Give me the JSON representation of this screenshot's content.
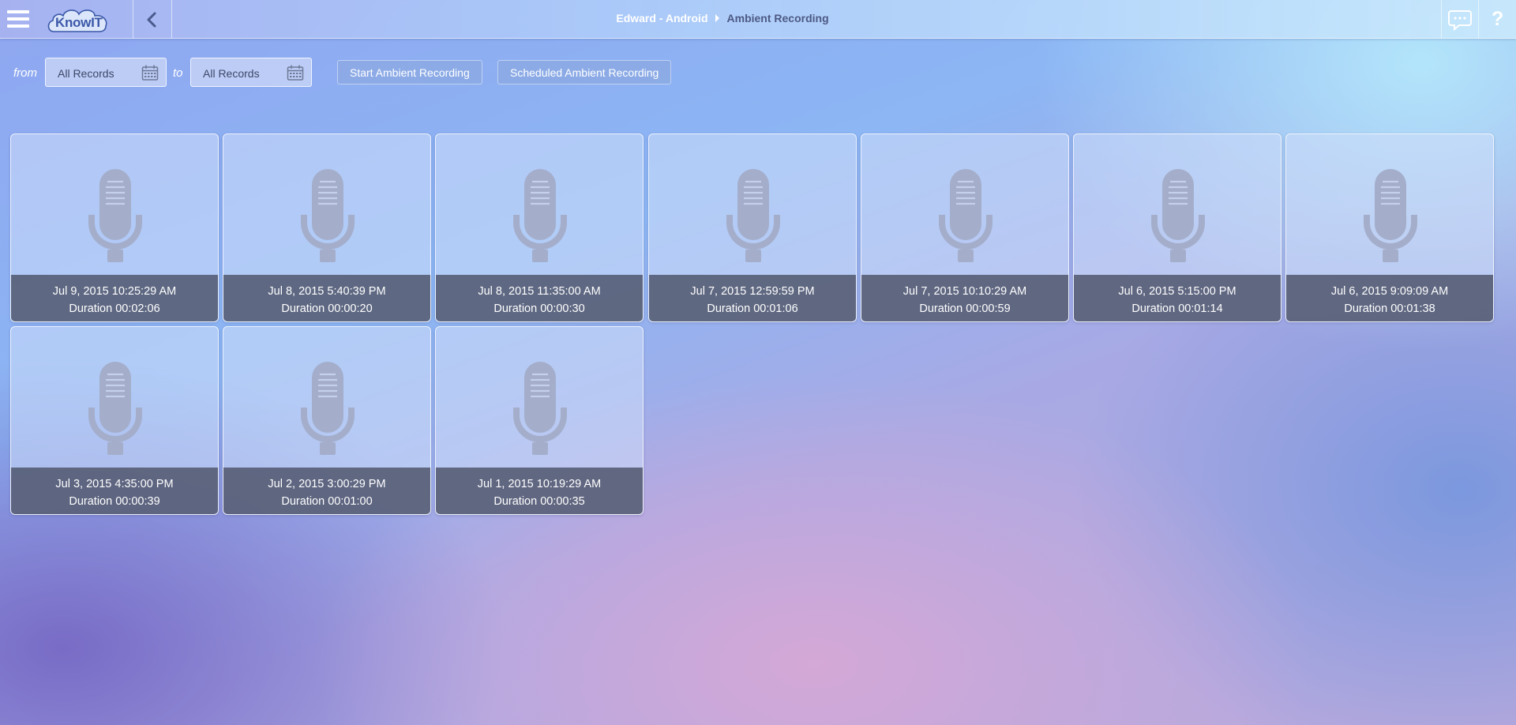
{
  "header": {
    "logo_text": "KnowIT",
    "breadcrumb": {
      "device": "Edward - Android",
      "current": "Ambient Recording"
    }
  },
  "icons": {
    "menu": "hamburger-menu-icon",
    "back": "chevron-left-icon",
    "chat": "chat-bubble-icon",
    "help": "question-mark-icon",
    "calendar": "calendar-icon",
    "microphone": "microphone-icon"
  },
  "help_glyph": "?",
  "filters": {
    "from_label": "from",
    "to_label": "to",
    "from_value": "All Records",
    "to_value": "All Records"
  },
  "actions": {
    "start": "Start Ambient Recording",
    "scheduled": "Scheduled Ambient Recording"
  },
  "recordings": [
    {
      "date": "Jul 9, 2015 10:25:29 AM",
      "duration": "Duration 00:02:06"
    },
    {
      "date": "Jul 8, 2015 5:40:39 PM",
      "duration": "Duration 00:00:20"
    },
    {
      "date": "Jul 8, 2015 11:35:00 AM",
      "duration": "Duration 00:00:30"
    },
    {
      "date": "Jul 7, 2015 12:59:59 PM",
      "duration": "Duration 00:01:06"
    },
    {
      "date": "Jul 7, 2015 10:10:29 AM",
      "duration": "Duration 00:00:59"
    },
    {
      "date": "Jul 6, 2015 5:15:00 PM",
      "duration": "Duration 00:01:14"
    },
    {
      "date": "Jul 6, 2015 9:09:09 AM",
      "duration": "Duration 00:01:38"
    },
    {
      "date": "Jul 3, 2015 4:35:00 PM",
      "duration": "Duration 00:00:39"
    },
    {
      "date": "Jul 2, 2015 3:00:29 PM",
      "duration": "Duration 00:01:00"
    },
    {
      "date": "Jul 1, 2015 10:19:29 AM",
      "duration": "Duration 00:00:35"
    }
  ],
  "colors": {
    "card_info_bg": "#4c5268",
    "mic_glyph": "#a4aecb",
    "breadcrumb_current": "#4d5a84"
  }
}
